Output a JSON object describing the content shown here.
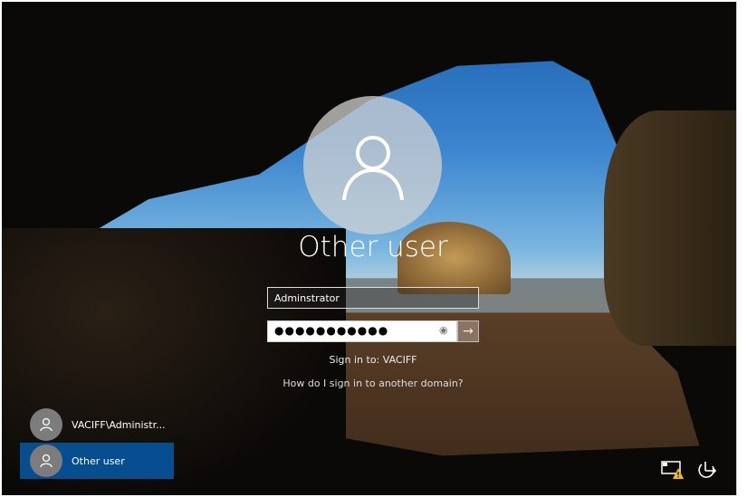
{
  "login": {
    "title": "Other user",
    "username_value": "Adminstrator",
    "password_mask": "●●●●●●●●●●●",
    "reveal_icon": "eye-icon",
    "submit_icon": "arrow-right-icon",
    "sign_in_to": "Sign in to: VACIFF",
    "domain_help": "How do I sign in to another domain?"
  },
  "accounts": [
    {
      "label": "VACIFF\\Administr...",
      "selected": false
    },
    {
      "label": "Other user",
      "selected": true
    }
  ],
  "tray": {
    "network": "network-warning-icon",
    "power": "power-icon"
  },
  "colors": {
    "selected": "#064e8f"
  }
}
